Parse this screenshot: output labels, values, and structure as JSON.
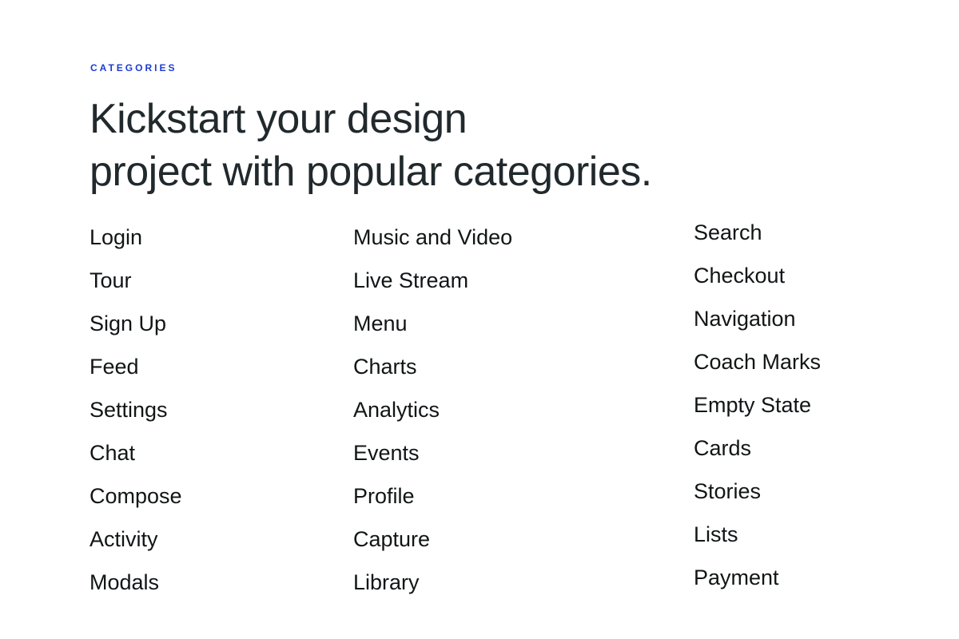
{
  "section": {
    "eyebrow": "CATEGORIES",
    "headline_line1": "Kickstart your design",
    "headline_line2": "project with popular categories."
  },
  "columns": [
    [
      "Login",
      "Tour",
      "Sign Up",
      "Feed",
      "Settings",
      "Chat",
      "Compose",
      "Activity",
      "Modals"
    ],
    [
      "Music and Video",
      "Live Stream",
      "Menu",
      "Charts",
      "Analytics",
      "Events",
      "Profile",
      "Capture",
      "Library"
    ],
    [
      "Search",
      "Checkout",
      "Navigation",
      "Coach Marks",
      "Empty State",
      "Cards",
      "Stories",
      "Lists",
      "Payment"
    ]
  ],
  "colors": {
    "accent": "#1d3bd1",
    "heading": "#21292d",
    "text": "#111516",
    "background": "#ffffff"
  }
}
